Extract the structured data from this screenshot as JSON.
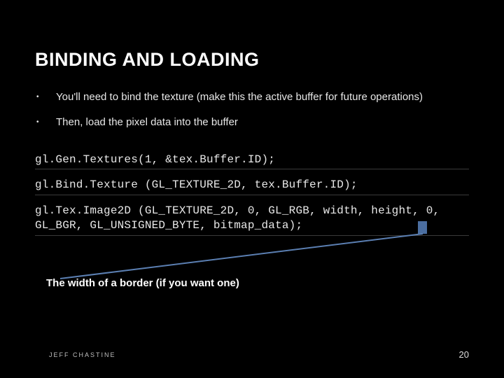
{
  "title": "BINDING AND LOADING",
  "bullets": [
    "You'll need to bind the texture (make this the active buffer for future operations)",
    "Then, load the pixel data into the buffer"
  ],
  "code": [
    "gl.Gen.Textures(1, &tex.Buffer.ID);",
    "gl.Bind.Texture (GL_TEXTURE_2D, tex.Buffer.ID);",
    "gl.Tex.Image2D (GL_TEXTURE_2D, 0, GL_RGB, width, height, 0, GL_BGR, GL_UNSIGNED_BYTE, bitmap_data);"
  ],
  "annotation": "The width of a border (if you want one)",
  "author": "JEFF CHASTINE",
  "page": "20"
}
